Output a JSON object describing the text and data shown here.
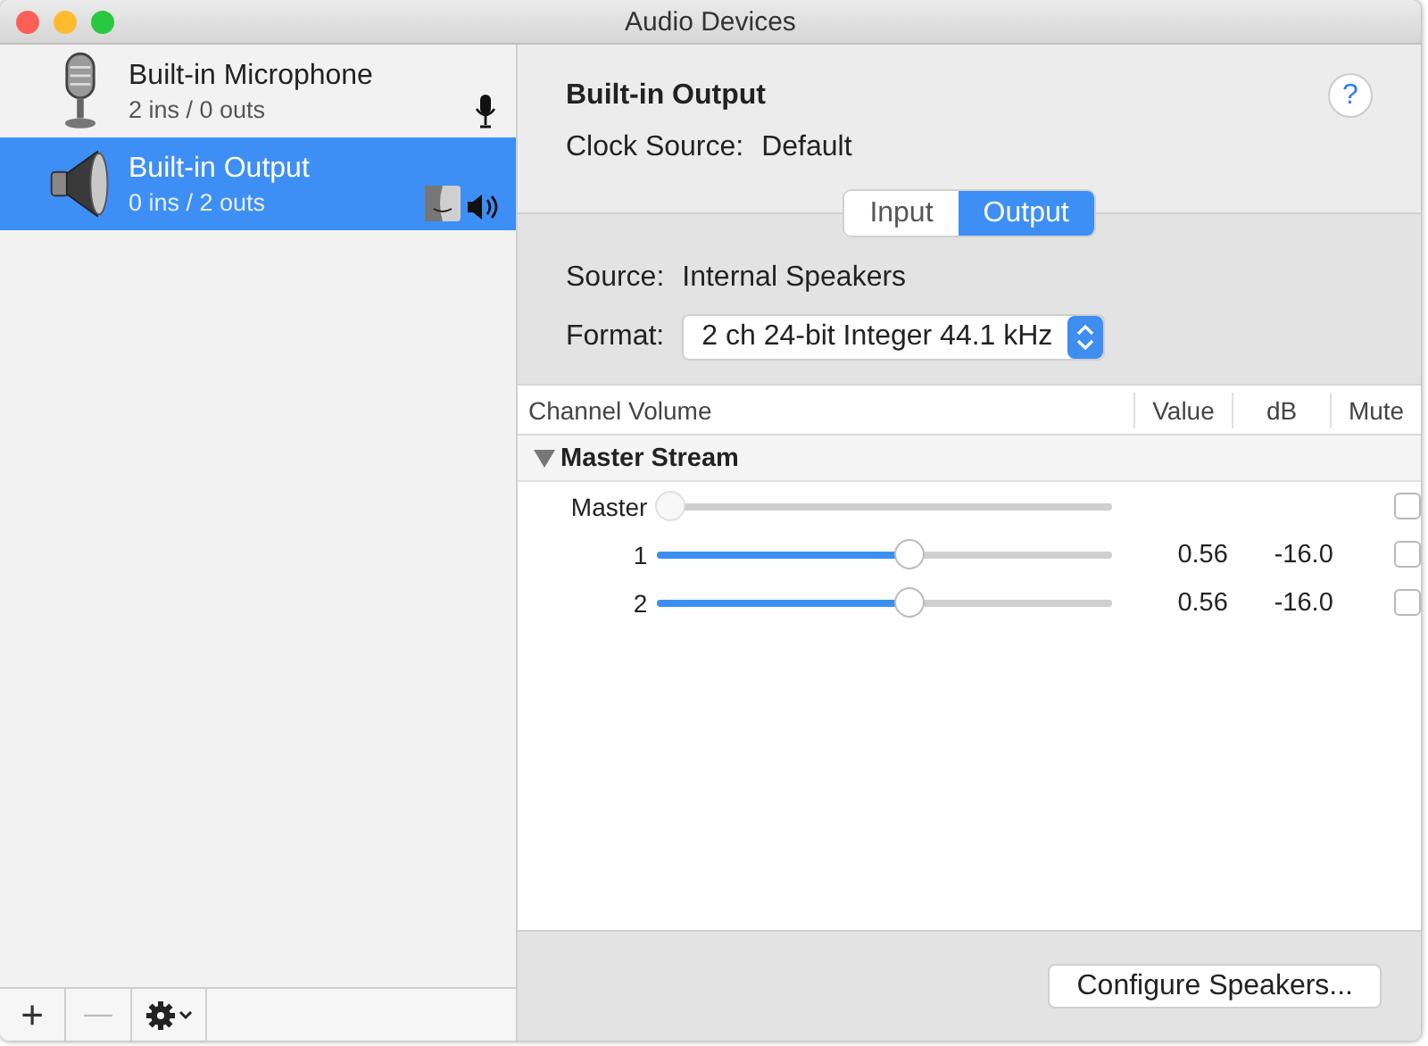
{
  "window": {
    "title": "Audio Devices"
  },
  "devices": [
    {
      "name": "Built-in Microphone",
      "io": "2 ins / 0 outs",
      "kind": "input",
      "selected": false
    },
    {
      "name": "Built-in Output",
      "io": "0 ins / 2 outs",
      "kind": "output",
      "selected": true
    }
  ],
  "sidebar_toolbar": {
    "add": "+",
    "remove": "—"
  },
  "detail": {
    "title": "Built-in Output",
    "clock_label": "Clock Source:",
    "clock_value": "Default",
    "help": "?",
    "tabs": [
      {
        "label": "Input",
        "selected": false
      },
      {
        "label": "Output",
        "selected": true
      }
    ],
    "source_label": "Source:",
    "source_value": "Internal Speakers",
    "format_label": "Format:",
    "format_value": "2 ch 24-bit Integer 44.1 kHz"
  },
  "table": {
    "columns": [
      "Channel Volume",
      "Value",
      "dB",
      "Mute"
    ],
    "group": {
      "label": "Master Stream",
      "expanded": true
    },
    "rows": [
      {
        "name": "Master",
        "level": 0,
        "disabled": true,
        "muted": false
      },
      {
        "name": "1",
        "level": 0.56,
        "disabled": false,
        "value": "0.56",
        "db": "-16.0",
        "muted": false
      },
      {
        "name": "2",
        "level": 0.56,
        "disabled": false,
        "value": "0.56",
        "db": "-16.0",
        "muted": false
      }
    ]
  },
  "buttons": [
    "Configure Speakers..."
  ]
}
